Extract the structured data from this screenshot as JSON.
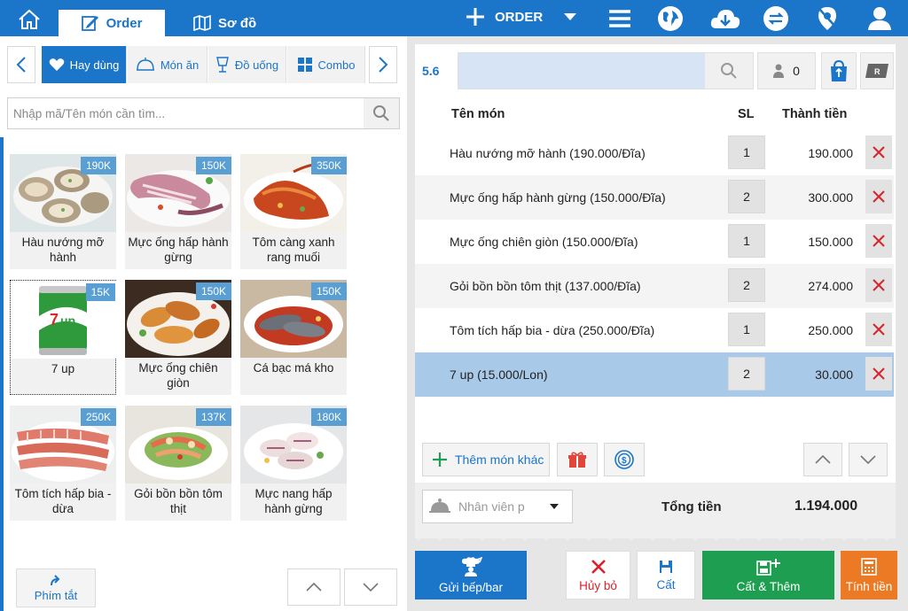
{
  "topbar": {
    "tabs": [
      {
        "label": "Order"
      },
      {
        "label": "Sơ đồ"
      }
    ],
    "order_label": "ORDER"
  },
  "categories": [
    {
      "label": "Hay dùng",
      "icon": "heart-icon",
      "active": true
    },
    {
      "label": "Món ăn",
      "icon": "cloche-icon",
      "active": false
    },
    {
      "label": "Đồ uống",
      "icon": "glass-icon",
      "active": false
    },
    {
      "label": "Combo",
      "icon": "grid-icon",
      "active": false
    }
  ],
  "search": {
    "placeholder": "Nhập mã/Tên món cần tìm..."
  },
  "menu_items": [
    {
      "name": "Hàu nướng mỡ hành",
      "price": "190K"
    },
    {
      "name": "Mực ống hấp hành gừng",
      "price": "150K"
    },
    {
      "name": "Tôm càng xanh rang muối",
      "price": "350K"
    },
    {
      "name": "7 up",
      "price": "15K"
    },
    {
      "name": "Mực ống chiên giòn",
      "price": "150K"
    },
    {
      "name": "Cá bạc má kho",
      "price": "150K"
    },
    {
      "name": "Tôm tích hấp bia - dừa",
      "price": "250K"
    },
    {
      "name": "Gỏi bồn bồn tôm thịt",
      "price": "137K"
    },
    {
      "name": "Mực nang hấp hành gừng",
      "price": "180K"
    }
  ],
  "left_footer": {
    "shortcut_label": "Phím tắt"
  },
  "order": {
    "table_no": "5.6",
    "guest_count": "0",
    "headers": {
      "name": "Tên món",
      "qty": "SL",
      "amount": "Thành tiền"
    },
    "rows": [
      {
        "name": "Hàu nướng mỡ hành (190.000/Đĩa)",
        "qty": "1",
        "amount": "190.000"
      },
      {
        "name": "Mực ống hấp hành gừng (150.000/Đĩa)",
        "qty": "2",
        "amount": "300.000"
      },
      {
        "name": "Mực ống chiên giòn (150.000/Đĩa)",
        "qty": "1",
        "amount": "150.000"
      },
      {
        "name": "Gỏi bồn bồn tôm thịt (137.000/Đĩa)",
        "qty": "2",
        "amount": "274.000"
      },
      {
        "name": "Tôm tích hấp bia - dừa (250.000/Đĩa)",
        "qty": "1",
        "amount": "250.000"
      },
      {
        "name": "7 up (15.000/Lon)",
        "qty": "2",
        "amount": "30.000"
      }
    ],
    "selected_row": 5,
    "add_other_label": "Thêm món khác",
    "staff_placeholder": "Nhân viên p",
    "total_label": "Tổng tiền",
    "total_value": "1.194.000"
  },
  "actions": {
    "send_kitchen": "Gửi bếp/bar",
    "cancel": "Hủy bỏ",
    "save": "Cất",
    "save_add": "Cất & Thêm",
    "checkout": "Tính tiền"
  },
  "colors": {
    "primary": "#1b75c8",
    "green": "#1e9e50",
    "orange": "#ec7a24",
    "danger": "#d9232d",
    "selected_row": "#a9c9e8"
  }
}
